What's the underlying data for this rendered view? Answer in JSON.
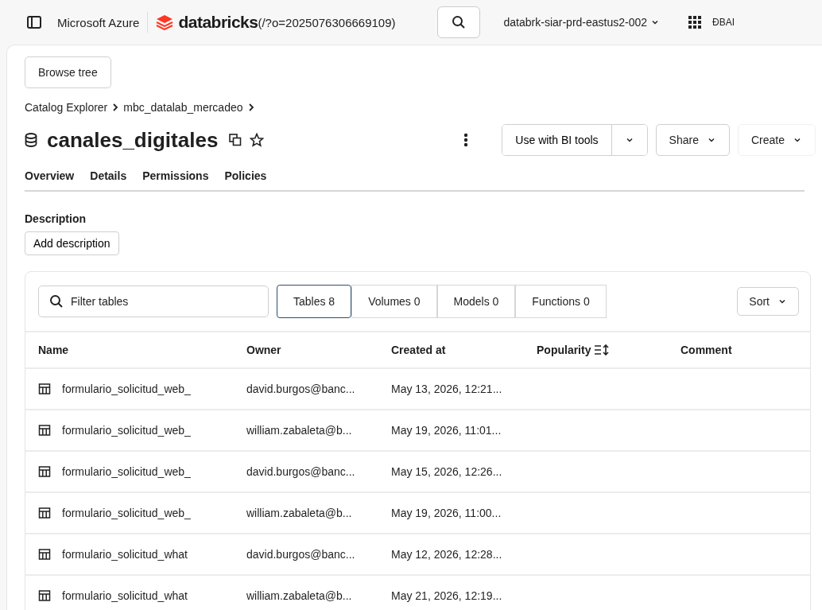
{
  "top_bar": {
    "brand": "Microsoft Azure",
    "product": "databricks",
    "org_query": "(/?o=2025076306669109)",
    "workspace": "databrk-siar-prd-eastus2-002",
    "user": "ÐBAI"
  },
  "browse_button": "Browse tree",
  "breadcrumb": [
    "Catalog Explorer",
    "mbc_datalab_mercadeo"
  ],
  "title": "canales_digitales",
  "actions": {
    "bi_tools": "Use with BI tools",
    "share": "Share",
    "create": "Create"
  },
  "tabs": [
    {
      "label": "Overview"
    },
    {
      "label": "Details"
    },
    {
      "label": "Permissions"
    },
    {
      "label": "Policies"
    }
  ],
  "description": {
    "label": "Description",
    "button": "Add description"
  },
  "filter": {
    "placeholder": "Filter tables"
  },
  "segments": [
    {
      "label": "Tables 8",
      "selected": true
    },
    {
      "label": "Volumes 0",
      "selected": false
    },
    {
      "label": "Models 0",
      "selected": false
    },
    {
      "label": "Functions 0",
      "selected": false
    }
  ],
  "sort_button": "Sort",
  "table": {
    "columns": [
      "Name",
      "Owner",
      "Created at",
      "Popularity",
      "Comment"
    ],
    "rows": [
      {
        "name": "formulario_solicitud_web_",
        "owner": "david.burgos@banc...",
        "created": "May 13, 2026, 12:21..."
      },
      {
        "name": "formulario_solicitud_web_",
        "owner": "william.zabaleta@b...",
        "created": "May 19, 2026, 11:01..."
      },
      {
        "name": "formulario_solicitud_web_",
        "owner": "david.burgos@banc...",
        "created": "May 15, 2026, 12:26..."
      },
      {
        "name": "formulario_solicitud_web_",
        "owner": "william.zabaleta@b...",
        "created": "May 19, 2026, 11:00..."
      },
      {
        "name": "formulario_solicitud_what",
        "owner": "david.burgos@banc...",
        "created": "May 12, 2026, 12:28..."
      },
      {
        "name": "formulario_solicitud_what",
        "owner": "william.zabaleta@b...",
        "created": "May 21, 2026, 12:19..."
      }
    ]
  }
}
